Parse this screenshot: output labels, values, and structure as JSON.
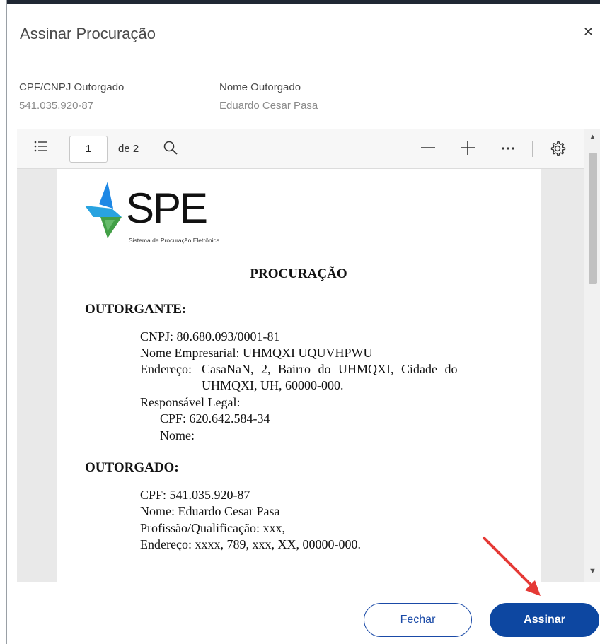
{
  "dialog": {
    "title": "Assinar Procuração",
    "close_icon": "close-icon"
  },
  "fields": {
    "cpf_cnpj_label": "CPF/CNPJ Outorgado",
    "cpf_cnpj_value": "541.035.920-87",
    "nome_label": "Nome Outorgado",
    "nome_value": "Eduardo Cesar Pasa"
  },
  "viewer": {
    "toolbar": {
      "page_number": "1",
      "page_of": "de 2",
      "icons": [
        "list-icon",
        "search-icon",
        "zoom-out-icon",
        "zoom-in-icon",
        "more-icon",
        "settings-icon"
      ]
    },
    "document": {
      "logo_text": "SPE",
      "logo_subtitle": "Sistema de Procuração Eletrônica",
      "title": "PROCURAÇÃO",
      "outorgante": {
        "heading": "OUTORGANTE:",
        "cnpj": "CNPJ: 80.680.093/0001-81",
        "nome_empresarial": "Nome Empresarial: UHMQXI UQUVHPWU",
        "endereco_label": "Endereço:",
        "endereco_line1": "CasaNaN,  2,  Bairro  do  UHMQXI,  Cidade  do",
        "endereco_line2": "UHMQXI, UH, 60000-000.",
        "responsavel": "Responsável Legal:",
        "resp_cpf": "CPF: 620.642.584-34",
        "resp_nome": "Nome:"
      },
      "outorgado": {
        "heading": "OUTORGADO:",
        "cpf": "CPF: 541.035.920-87",
        "nome": "Nome: Eduardo Cesar Pasa",
        "profissao": "Profissão/Qualificação: xxx,",
        "endereco": "Endereço: xxxx, 789, xxx, XX, 00000-000."
      }
    }
  },
  "buttons": {
    "fechar": "Fechar",
    "assinar": "Assinar"
  },
  "colors": {
    "primary": "#0d47a1",
    "annotation_arrow": "#e53935",
    "logo_blue": "#1e88e5",
    "logo_green": "#43a047"
  }
}
